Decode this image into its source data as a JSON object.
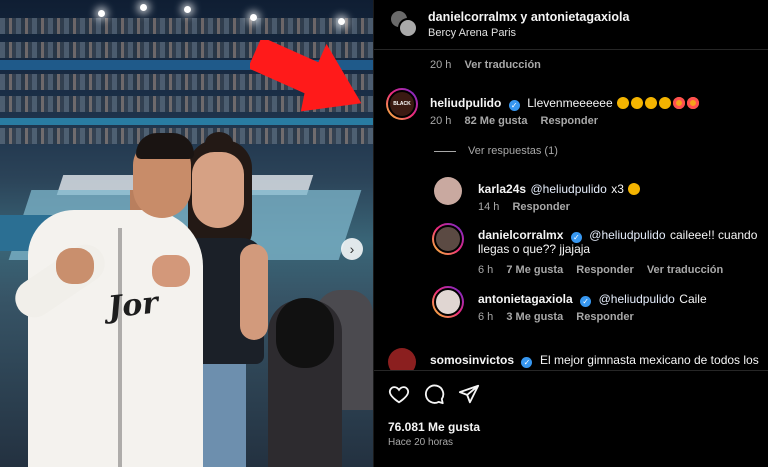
{
  "post": {
    "header": {
      "title": "danielcorralmx y antonietagaxiola",
      "location": "Bercy Arena Paris"
    },
    "caption_meta": {
      "time": "20 h",
      "translate": "Ver traducción"
    },
    "comments": [
      {
        "username": "heliudpulido",
        "verified": true,
        "text": "Llevenmeeeeee",
        "emojis": [
          "crying-face",
          "crying-face",
          "crying-face",
          "crying-face",
          "star-struck",
          "heart-eyes"
        ],
        "time": "20 h",
        "likes": "82 Me gusta",
        "reply": "Responder",
        "avatar_text": "BLACK",
        "view_replies": "Ver respuestas (1)"
      },
      {
        "username": "karla24s",
        "verified": false,
        "mention": "@heliudpulido",
        "text": "x3",
        "emoji": "folded-hands",
        "time": "14 h",
        "reply": "Responder"
      },
      {
        "username": "danielcorralmx",
        "verified": true,
        "mention": "@heliudpulido",
        "text_line1": "caileee!! cuando",
        "text_line2": "llegas o que?? jjajaja",
        "time": "6 h",
        "likes": "7 Me gusta",
        "reply": "Responder",
        "translate": "Ver traducción"
      },
      {
        "username": "antonietagaxiola",
        "verified": true,
        "mention": "@heliudpulido",
        "text": "Caile",
        "time": "6 h",
        "likes": "3 Me gusta",
        "reply": "Responder"
      },
      {
        "username": "somosinvictos",
        "verified": true,
        "text": "El mejor gimnasta mexicano de todos los"
      }
    ],
    "actions": {
      "likes": "76.081 Me gusta",
      "posted": "Hace 20 horas"
    },
    "photo": {
      "jersey_text": "Jor"
    }
  },
  "colors": {
    "background": "#000000",
    "text": "#f5f5f5",
    "secondary": "#a8a8a8",
    "verified": "#3797f0",
    "arrow": "#ff1a1a"
  }
}
